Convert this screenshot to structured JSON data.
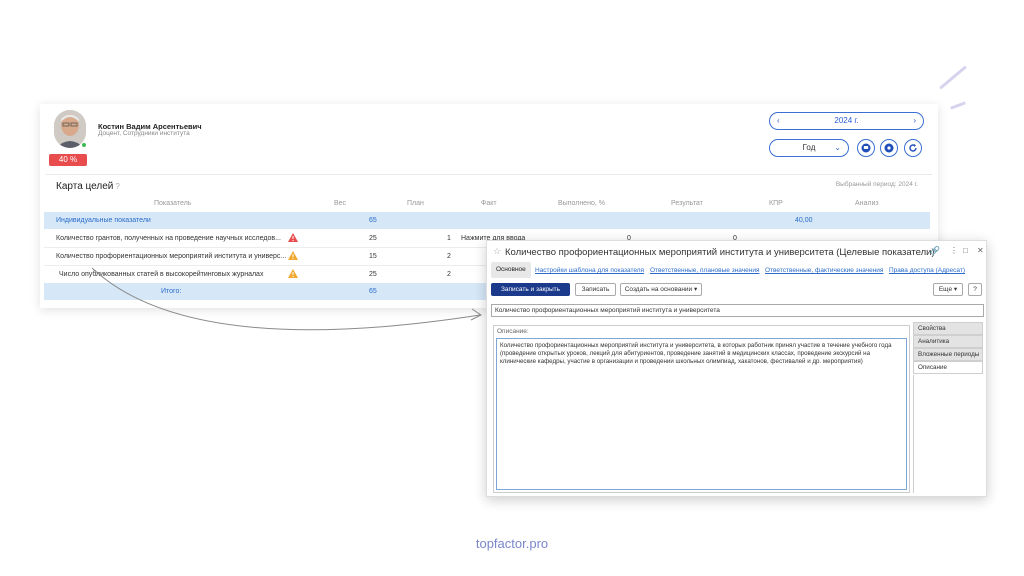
{
  "user": {
    "name": "Костин Вадим Арсентьевич",
    "role": "Доцент, Сотрудники института",
    "progress": "40 %"
  },
  "period": {
    "prev": "‹",
    "year": "2024 г.",
    "next": "›",
    "type": "Год",
    "type_chevron": "⌄"
  },
  "goals": {
    "title": "Карта целей",
    "help": "?",
    "selected_period": "Выбранный период: 2024 г.",
    "columns": [
      "Показатель",
      "Вес",
      "План",
      "Факт",
      "Выполнено, %",
      "Результат",
      "КПР",
      "Анализ"
    ],
    "group_row": {
      "name": "Индивидуальные показатели",
      "weight": "65",
      "kpr": "40,00"
    },
    "rows": [
      {
        "name": "Количество грантов, полученных на проведение научных исследов...",
        "weight": "25",
        "plan": "1",
        "fact": "Нажмите для ввода",
        "done": "0",
        "result": "0",
        "warn_color": "#e84c4c"
      },
      {
        "name": "Количество профориентационных мероприятий института и универс...",
        "weight": "15",
        "plan": "2",
        "fact": "",
        "done": "",
        "result": "",
        "warn_color": "#f0a830"
      },
      {
        "name": "Число опубликованных статей в высокорейтинговых журналах",
        "weight": "25",
        "plan": "2",
        "fact": "",
        "done": "",
        "result": "",
        "warn_color": "#f0a830"
      }
    ],
    "total_row": {
      "name": "Итого:",
      "weight": "65"
    }
  },
  "dialog": {
    "title": "Количество профориентационных мероприятий института и университета (Целевые показатели)",
    "tabs": [
      "Основное",
      "Настройки шаблона для показателя",
      "Ответственные, плановые значения",
      "Ответственные, фактические значения",
      "Права доступа (Адресат)"
    ],
    "buttons": {
      "save_close": "Записать и закрыть",
      "save": "Записать",
      "create_basis": "Создать на основании ▾",
      "more": "Еще ▾",
      "help": "?"
    },
    "name_value": "Количество профориентационных мероприятий института и университета",
    "description_label": "Описание:",
    "description_text": "Количество профориентационных мероприятий института и университета, в которых работник принял участие в течение учебного года (проведение открытых уроков, лекций для абитуриентов, проведение занятий в медицинских классах, проведение экскурсий на клинические кафедры, участие в организации и проведении школьных олимпиад, хакатонов, фестивалей и др. мероприятия)",
    "side_tabs": [
      "Свойства",
      "Аналитика",
      "Вложенные периоды",
      "Описание"
    ]
  },
  "footer": {
    "brand": "topfactor.pro"
  }
}
